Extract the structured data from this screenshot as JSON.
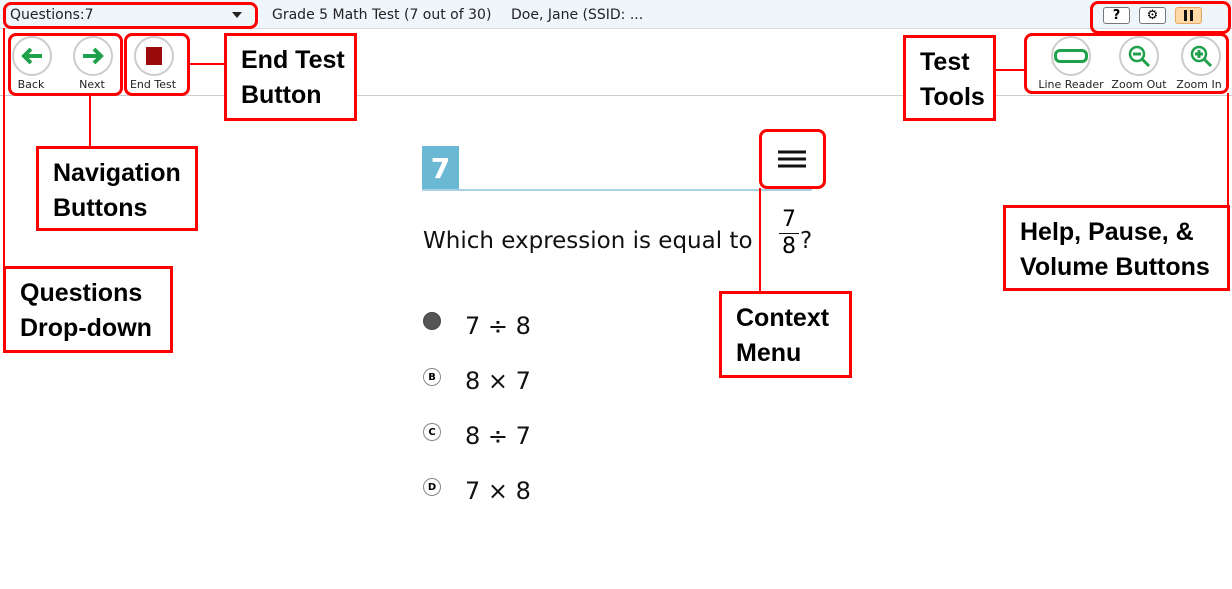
{
  "header": {
    "questions_label": "Questions:",
    "questions_value": "7",
    "test_title": "Grade 5 Math Test (7 out of 30)",
    "student": "Doe, Jane (SSID: ...",
    "help": "?",
    "settings_icon": "gear-icon",
    "pause_icon": "pause-icon"
  },
  "nav": {
    "back": "Back",
    "next": "Next",
    "end_test": "End Test"
  },
  "tools": {
    "line_reader": "Line Reader",
    "zoom_out": "Zoom Out",
    "zoom_in": "Zoom In"
  },
  "question": {
    "number": "7",
    "text": "Which expression is equal to",
    "frac_num": "7",
    "frac_den": "8",
    "suffix": "?",
    "options": [
      {
        "letter": "A",
        "text": "7 ÷ 8",
        "selected": true
      },
      {
        "letter": "B",
        "text": "8 × 7"
      },
      {
        "letter": "C",
        "text": "8 ÷ 7"
      },
      {
        "letter": "D",
        "text": "7 × 8"
      }
    ]
  },
  "callouts": {
    "end_test": "End Test Button",
    "test_tools": "Test Tools",
    "navigation": "Navigation Buttons",
    "questions": "Questions Drop-down",
    "help": "Help, Pause, & Volume Buttons",
    "context": "Context Menu"
  },
  "colors": {
    "annotation": "#ff0000",
    "accent": "#6bb8d4",
    "green": "#1fa04a",
    "end": "#9b0b0b",
    "pause": "#ffd9a8"
  }
}
